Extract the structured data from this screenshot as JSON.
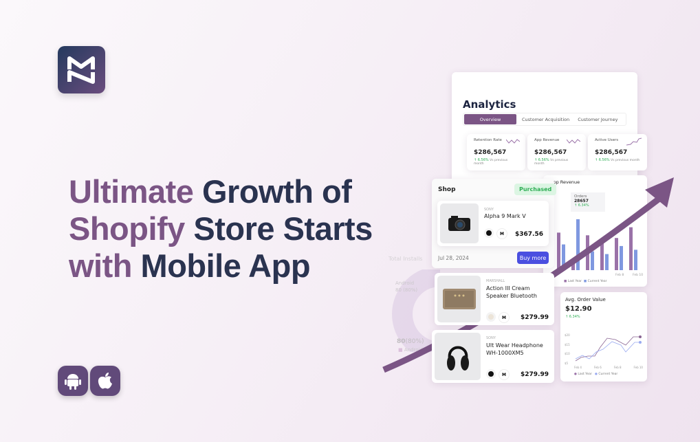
{
  "brand": {
    "logo_letters": "MN"
  },
  "headline": {
    "l1a": "Ultimate",
    "l1b": "Growth of",
    "l2a": "Shopify",
    "l2b": "Store Starts",
    "l3a": "with",
    "l3b": "Mobile App"
  },
  "platforms": [
    "android-icon",
    "apple-icon"
  ],
  "colors": {
    "purple": "#7b5585",
    "navy": "#2a3350",
    "blue": "#4a4fe0",
    "bar_current": "#7f98e0",
    "green": "#2fae55"
  },
  "analytics": {
    "title": "Analytics",
    "tabs": [
      {
        "label": "Overview",
        "active": true
      },
      {
        "label": "Customer Acquisition"
      },
      {
        "label": "Customer Journey"
      }
    ],
    "stats": [
      {
        "label": "Retention Rate",
        "value": "$286,567",
        "change": "↑ 6.56%",
        "note": "Vs previous month"
      },
      {
        "label": "App Revenue",
        "value": "$286,567",
        "change": "↑ 6.56%",
        "note": "Vs previous month"
      },
      {
        "label": "Active Users",
        "value": "$286,567",
        "change": "↑ 6.56%",
        "note": "Vs previous month"
      }
    ],
    "revenue": {
      "title": "App Revenue",
      "orders_label": "Orders",
      "orders_value": "28657",
      "orders_change": "↑ 6.34%",
      "x_labels": [
        "Feb 8",
        "Feb 10"
      ],
      "legend": [
        "Last Year",
        "Current Year"
      ],
      "last_year": [
        70,
        15,
        65,
        50,
        60,
        80
      ],
      "current_year": [
        48,
        95,
        35,
        30,
        45,
        38
      ]
    },
    "aov": {
      "title": "Avg. Order Value",
      "value": "$12.90",
      "change": "↑ 6.34%",
      "y_labels": [
        "$20",
        "$15",
        "$10",
        "$5"
      ],
      "x_labels": [
        "Feb 4",
        "Feb 6",
        "Feb 8",
        "Feb 10"
      ],
      "legend": [
        "Last Year",
        "Current Year"
      ]
    },
    "donut": {
      "title": "Total Installs",
      "android_label": "Android",
      "android_value": "80 (80%)",
      "bottom_value": "80",
      "bottom_pct": "(80%)"
    }
  },
  "shop": {
    "title": "Shop",
    "badge": "Purchased",
    "date": "Jul 28, 2024",
    "buy_more": "Buy more",
    "products": [
      {
        "brand": "SONY",
        "name": "Alpha 9 Mark V",
        "size": "M",
        "price": "$367.56",
        "color": "#111"
      },
      {
        "brand": "MARSHALL",
        "name": "Action III Cream Speaker Bluetooth",
        "size": "M",
        "price": "$279.99",
        "color": "#ece4d8"
      },
      {
        "brand": "SONY",
        "name": "Ult Wear Headphone WH-1000XM5",
        "size": "M",
        "price": "$279.99",
        "color": "#111"
      }
    ]
  }
}
